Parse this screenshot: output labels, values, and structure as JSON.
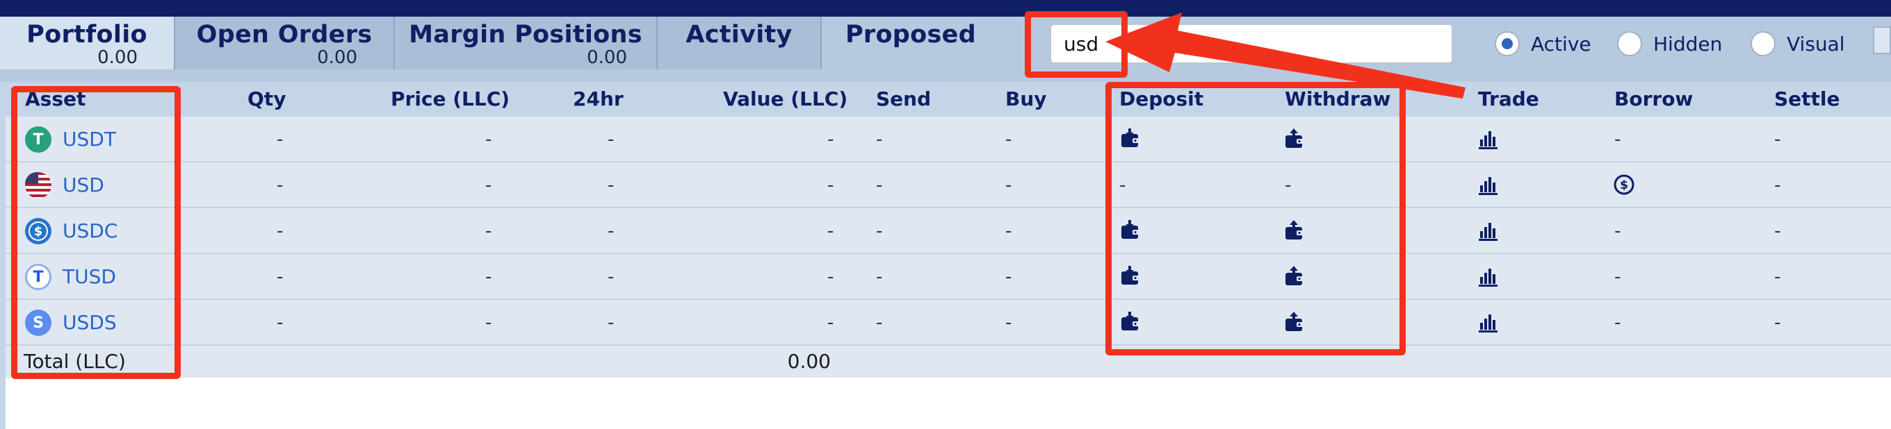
{
  "tabs": [
    {
      "label": "Portfolio",
      "count": "0.00",
      "active": true
    },
    {
      "label": "Open Orders",
      "count": "0.00",
      "active": false
    },
    {
      "label": "Margin Positions",
      "count": "0.00",
      "active": false
    },
    {
      "label": "Activity",
      "count": "",
      "active": false
    },
    {
      "label": "Proposed",
      "count": "",
      "active": false
    }
  ],
  "search": {
    "value": "usd",
    "placeholder": ""
  },
  "filters": [
    {
      "label": "Active",
      "checked": true
    },
    {
      "label": "Hidden",
      "checked": false
    },
    {
      "label": "Visual",
      "checked": false
    }
  ],
  "table": {
    "columns": {
      "asset": "Asset",
      "qty": "Qty",
      "price": "Price (LLC)",
      "change": "24hr",
      "value": "Value (LLC)",
      "send": "Send",
      "buy": "Buy",
      "deposit": "Deposit",
      "withdraw": "Withdraw",
      "trade": "Trade",
      "borrow": "Borrow",
      "settle": "Settle"
    },
    "rows": [
      {
        "asset": "USDT",
        "icon": "tether-coin-icon",
        "color": "#26a17b",
        "glyph": "T",
        "qty": "-",
        "price": "-",
        "change": "-",
        "value": "-",
        "send": "-",
        "buy": "-",
        "deposit": true,
        "withdraw": true,
        "borrow": "-",
        "settle": "-"
      },
      {
        "asset": "USD",
        "icon": "us-flag-icon",
        "color": "#b22234",
        "glyph": "",
        "qty": "-",
        "price": "-",
        "change": "-",
        "value": "-",
        "send": "-",
        "buy": "-",
        "deposit": false,
        "withdraw": false,
        "deposit_text": "-",
        "withdraw_text": "-",
        "borrow_icon": true,
        "settle": "-"
      },
      {
        "asset": "USDC",
        "icon": "usdc-coin-icon",
        "color": "#2775ca",
        "glyph": "$",
        "qty": "-",
        "price": "-",
        "change": "-",
        "value": "-",
        "send": "-",
        "buy": "-",
        "deposit": true,
        "withdraw": true,
        "borrow": "-",
        "settle": "-"
      },
      {
        "asset": "TUSD",
        "icon": "tusd-coin-icon",
        "color": "#1a5aff",
        "glyph": "T",
        "qty": "-",
        "price": "-",
        "change": "-",
        "value": "-",
        "send": "-",
        "buy": "-",
        "deposit": true,
        "withdraw": true,
        "borrow": "-",
        "settle": "-"
      },
      {
        "asset": "USDS",
        "icon": "usds-coin-icon",
        "color": "#5b8def",
        "glyph": "S",
        "qty": "-",
        "price": "-",
        "change": "-",
        "value": "-",
        "send": "-",
        "buy": "-",
        "deposit": true,
        "withdraw": true,
        "borrow": "-",
        "settle": "-"
      }
    ],
    "total": {
      "label": "Total (LLC)",
      "value": "0.00"
    }
  },
  "colors": {
    "accent": "#2a64c8",
    "header": "#0e1f63",
    "annotation": "#f2311d"
  }
}
